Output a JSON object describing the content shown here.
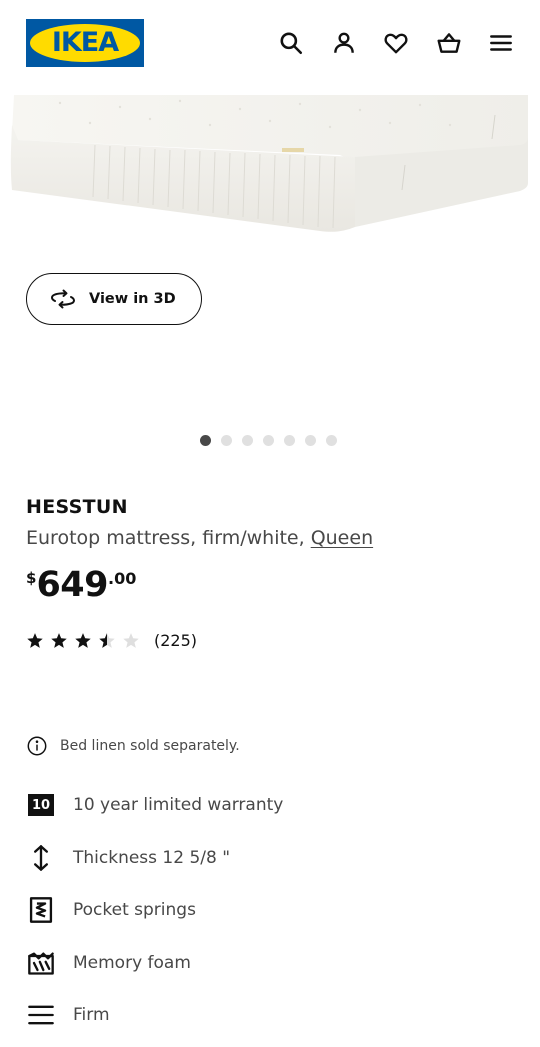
{
  "header": {
    "logo_text": "IKEA",
    "icons": [
      "search-icon",
      "account-icon",
      "heart-icon",
      "basket-icon",
      "menu-icon"
    ]
  },
  "gallery": {
    "view3d_label": "View in 3D",
    "slide_count": 7,
    "active_slide": 1
  },
  "product": {
    "name": "HESSTUN",
    "description": "Eurotop mattress, firm/white, ",
    "size": "Queen",
    "price": {
      "currency": "$",
      "integer": "649",
      "decimal": ".00"
    },
    "rating": {
      "value": 3.5,
      "max": 5,
      "count": "(225)"
    }
  },
  "notice": {
    "text": "Bed linen sold separately."
  },
  "features": [
    {
      "icon": "warranty-10-icon",
      "badge": "10",
      "text": "10 year limited warranty"
    },
    {
      "icon": "thickness-icon",
      "text": "Thickness 12 5/8 \""
    },
    {
      "icon": "pocket-springs-icon",
      "text": "Pocket springs"
    },
    {
      "icon": "memory-foam-icon",
      "text": "Memory foam"
    },
    {
      "icon": "firmness-icon",
      "text": "Firm"
    }
  ],
  "colors": {
    "brand_blue": "#0058a3",
    "brand_yellow": "#ffdb00",
    "text_primary": "#111111",
    "text_secondary": "#484848",
    "dot_active": "#484848",
    "dot_inactive": "#e0e0e0"
  }
}
